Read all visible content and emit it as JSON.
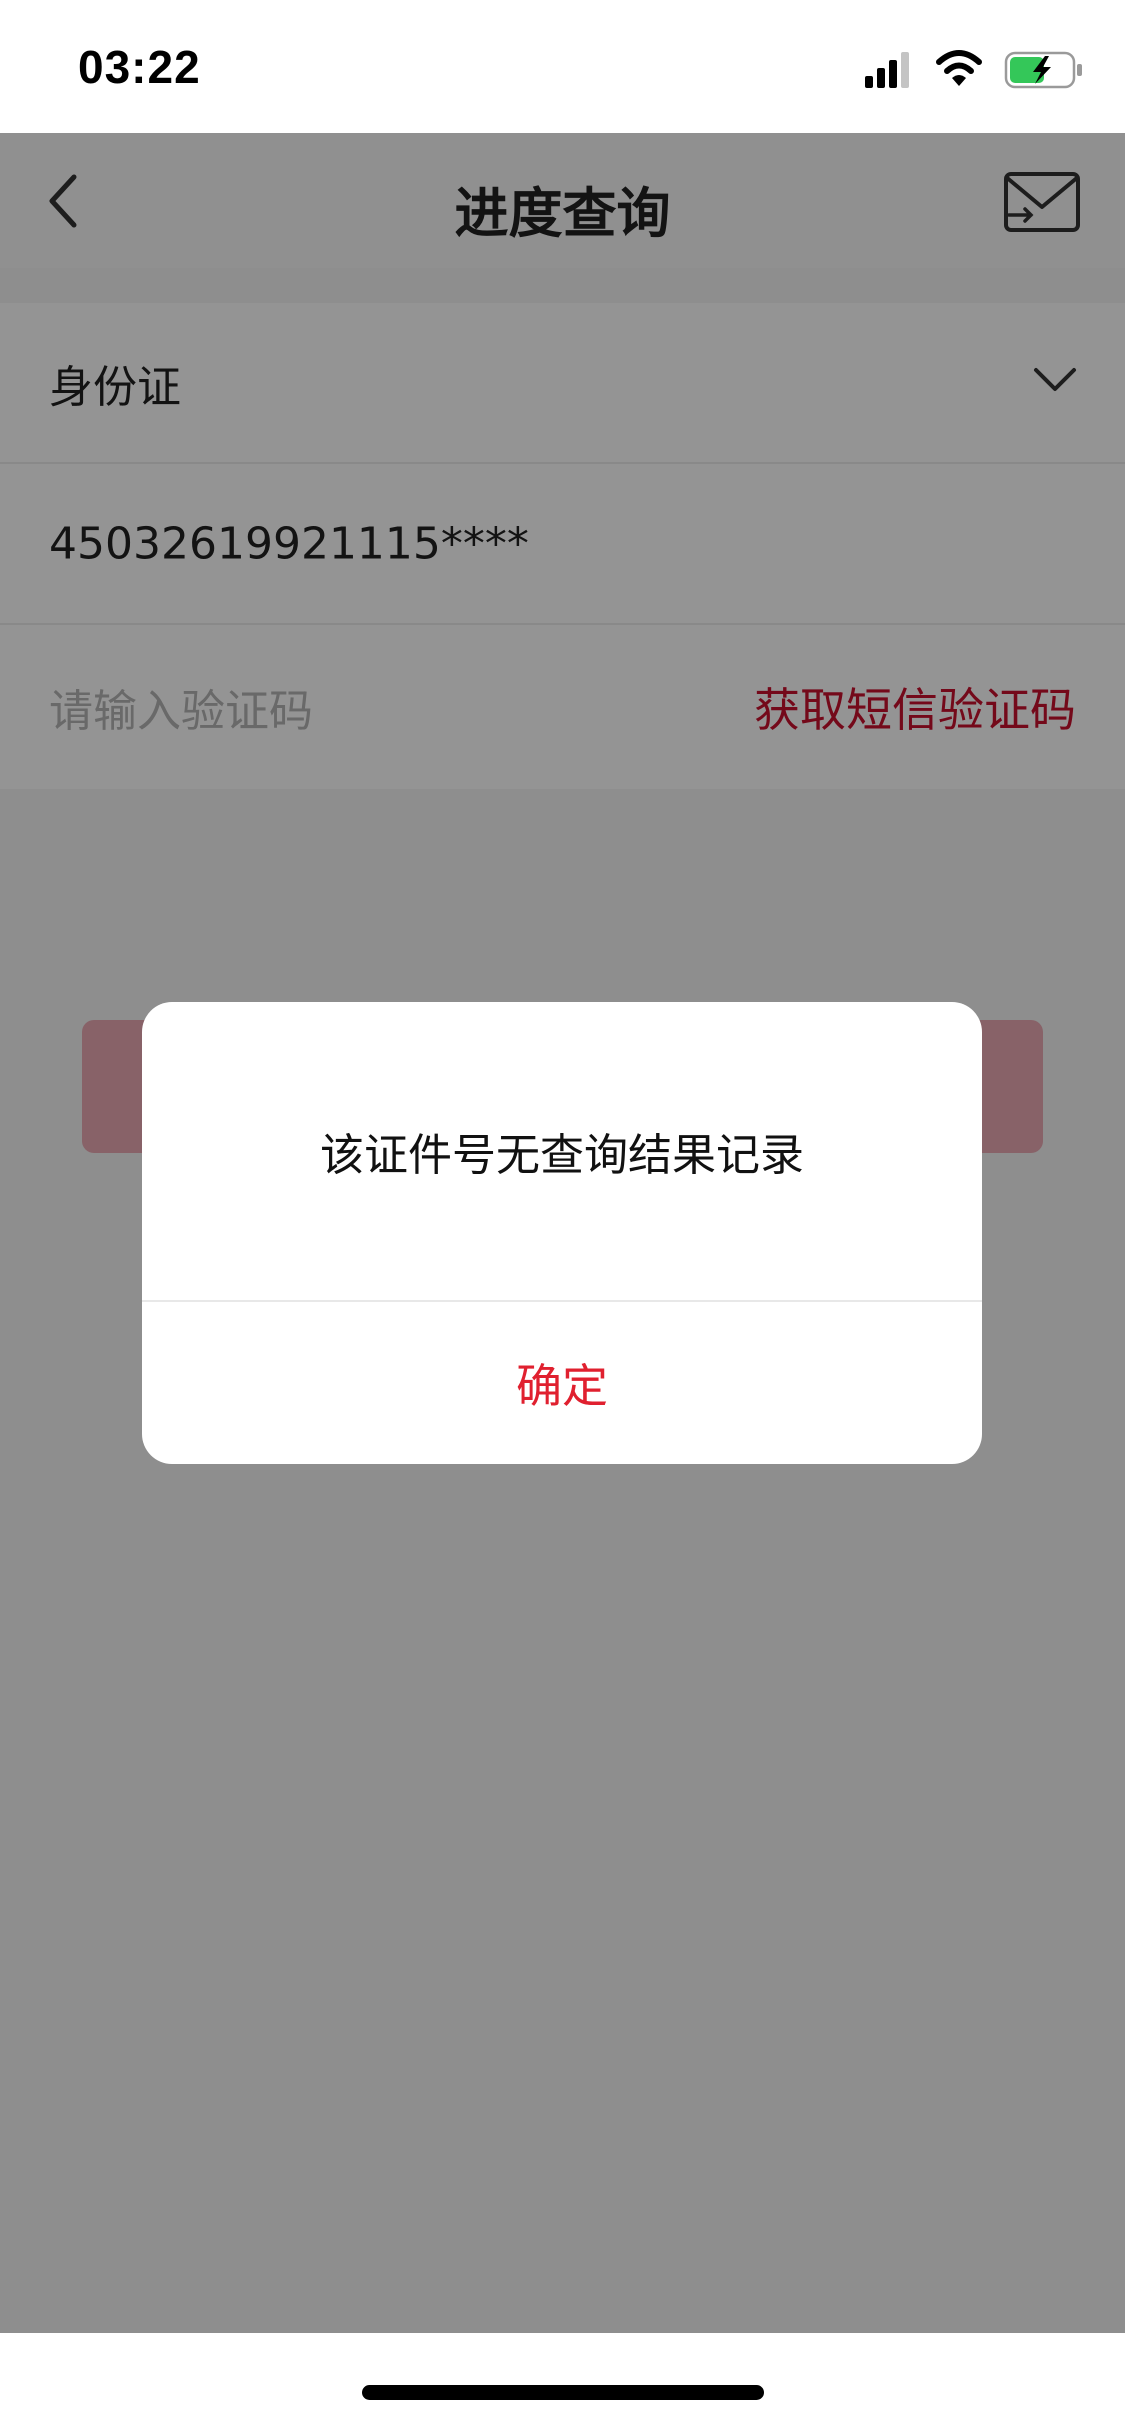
{
  "status_bar": {
    "time": "03:22",
    "icons": [
      "cellular-signal-icon",
      "wifi-icon",
      "battery-charging-icon"
    ]
  },
  "nav": {
    "title": "进度查询",
    "back_icon": "chevron-left-icon",
    "mail_icon": "envelope-icon"
  },
  "form": {
    "id_type": {
      "value": "身份证",
      "icon": "chevron-down-icon"
    },
    "id_number": {
      "value": "45032619921115****"
    },
    "verification": {
      "placeholder": "请输入验证码",
      "get_code_label": "获取短信验证码"
    }
  },
  "dialog": {
    "message": "该证件号无查询结果记录",
    "confirm_label": "确定"
  },
  "colors": {
    "accent": "#c8102e",
    "confirm_text": "#e0202f",
    "overlay": "rgba(0,0,0,0.42)"
  }
}
